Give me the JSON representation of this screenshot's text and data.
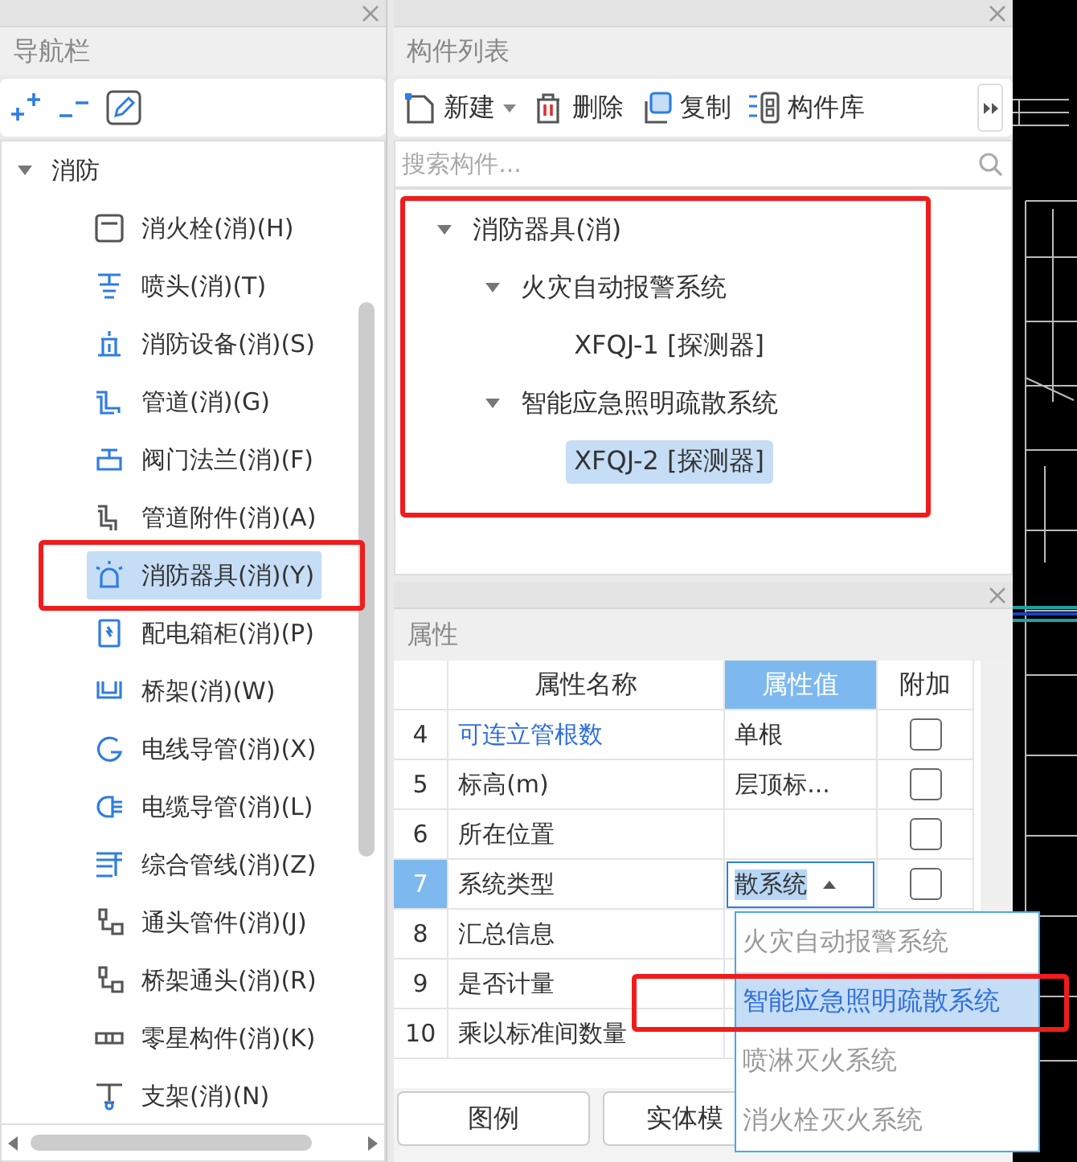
{
  "nav_panel": {
    "title": "导航栏",
    "tree": [
      {
        "label": "消防",
        "expanded": true,
        "children": [
          {
            "label": "消火栓(消)(H)",
            "selected": false,
            "highlighted": false
          },
          {
            "label": "喷头(消)(T)",
            "selected": false,
            "highlighted": false
          },
          {
            "label": "消防设备(消)(S)",
            "selected": false,
            "highlighted": false
          },
          {
            "label": "管道(消)(G)",
            "selected": false,
            "highlighted": false
          },
          {
            "label": "阀门法兰(消)(F)",
            "selected": false,
            "highlighted": false
          },
          {
            "label": "管道附件(消)(A)",
            "selected": false,
            "highlighted": false
          },
          {
            "label": "消防器具(消)(Y)",
            "selected": true,
            "highlighted": true
          },
          {
            "label": "配电箱柜(消)(P)",
            "selected": false,
            "highlighted": false
          },
          {
            "label": "桥架(消)(W)",
            "selected": false,
            "highlighted": false
          },
          {
            "label": "电线导管(消)(X)",
            "selected": false,
            "highlighted": false
          },
          {
            "label": "电缆导管(消)(L)",
            "selected": false,
            "highlighted": false
          },
          {
            "label": "综合管线(消)(Z)",
            "selected": false,
            "highlighted": false
          },
          {
            "label": "通头管件(消)(J)",
            "selected": false,
            "highlighted": false
          },
          {
            "label": "桥架通头(消)(R)",
            "selected": false,
            "highlighted": false
          },
          {
            "label": "零星构件(消)(K)",
            "selected": false,
            "highlighted": false
          },
          {
            "label": "支架(消)(N)",
            "selected": false,
            "highlighted": false
          }
        ]
      }
    ]
  },
  "component_panel": {
    "title": "构件列表",
    "toolbar": [
      {
        "kind": "new",
        "label": "新建",
        "has_menu": true
      },
      {
        "kind": "delete",
        "label": "删除",
        "has_menu": false
      },
      {
        "kind": "copy",
        "label": "复制",
        "has_menu": false
      },
      {
        "kind": "library",
        "label": "构件库",
        "has_menu": false
      }
    ],
    "search": {
      "placeholder": "搜索构件..."
    },
    "highlighted": true,
    "tree": [
      {
        "label": "消防器具(消)",
        "expanded": true,
        "selected": false,
        "children": [
          {
            "label": "火灾自动报警系统",
            "expanded": true,
            "selected": false,
            "children": [
              {
                "label": "XFQJ-1 [探测器]",
                "selected": false
              }
            ]
          },
          {
            "label": "智能应急照明疏散系统",
            "expanded": true,
            "selected": false,
            "children": [
              {
                "label": "XFQJ-2 [探测器]",
                "selected": true
              }
            ]
          }
        ]
      }
    ]
  },
  "properties_panel": {
    "title": "属性",
    "columns": [
      {
        "label": "属性名称",
        "selected": false
      },
      {
        "label": "属性值",
        "selected": true
      },
      {
        "label": "附加",
        "selected": false
      }
    ],
    "rows": [
      {
        "number": "4",
        "name": "可连立管根数",
        "emphasized": true,
        "value": "单根",
        "editing": false,
        "checked": false,
        "selected": false
      },
      {
        "number": "5",
        "name": "标高(m)",
        "emphasized": false,
        "value": "层顶标...",
        "editing": false,
        "checked": false,
        "selected": false
      },
      {
        "number": "6",
        "name": "所在位置",
        "emphasized": false,
        "editing": false,
        "checked": false,
        "selected": false
      },
      {
        "number": "7",
        "name": "系统类型",
        "emphasized": false,
        "value": "散系统",
        "editing": true,
        "checked": false,
        "selected": true
      },
      {
        "number": "8",
        "name": "汇总信息",
        "emphasized": false,
        "editing": false,
        "selected": false
      },
      {
        "number": "9",
        "name": "是否计量",
        "emphasized": false,
        "editing": false,
        "selected": false
      },
      {
        "number": "10",
        "name": "乘以标准间数量",
        "emphasized": false,
        "editing": false,
        "selected": false
      }
    ],
    "buttons": [
      {
        "label": "图例"
      },
      {
        "label": "实体模"
      }
    ],
    "dropdown": {
      "options": [
        {
          "label": "火灾自动报警系统",
          "selected": false,
          "highlighted": false
        },
        {
          "label": "智能应急照明疏散系统",
          "selected": true,
          "highlighted": true
        },
        {
          "label": "喷淋灭火系统",
          "selected": false,
          "highlighted": false
        },
        {
          "label": "消火栓灭火系统",
          "selected": false,
          "highlighted": false
        }
      ]
    }
  }
}
